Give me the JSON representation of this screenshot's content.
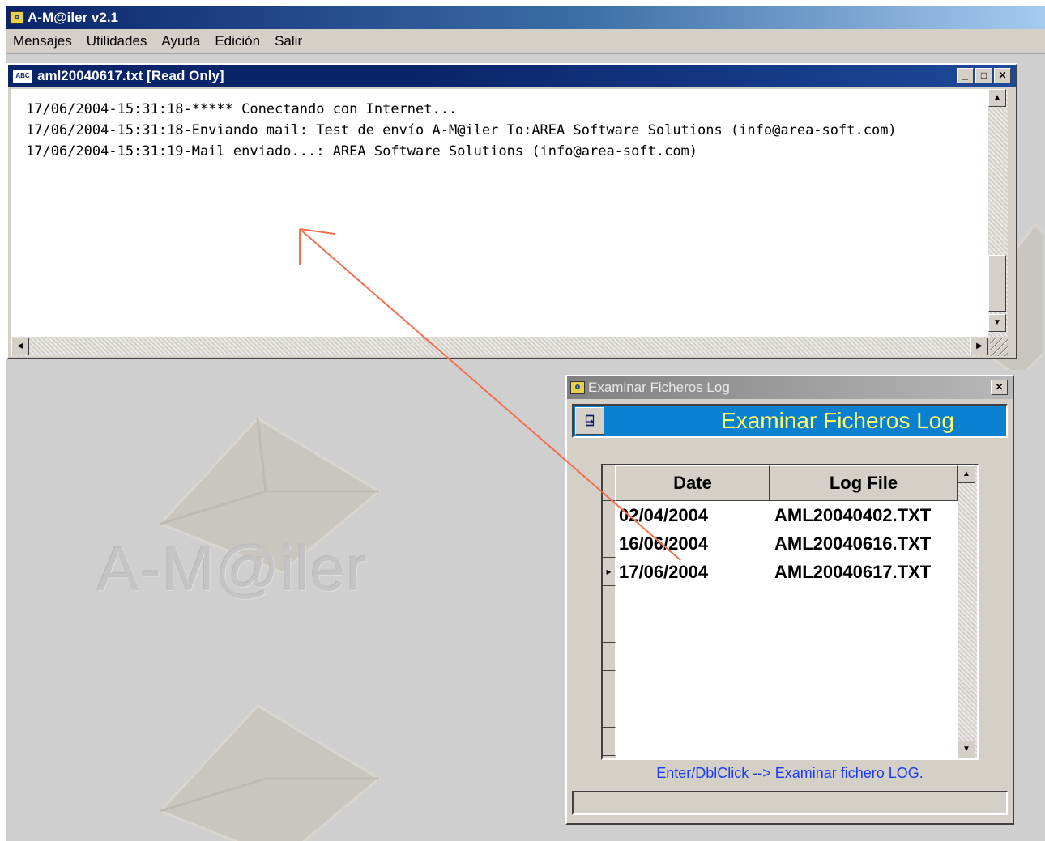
{
  "app": {
    "title": "A-M@iler v2.1",
    "menu": [
      "Mensajes",
      "Utilidades",
      "Ayuda",
      "Edición",
      "Salir"
    ]
  },
  "watermark": {
    "text": "A-M@iler",
    "color": "#c4c4c4"
  },
  "log_window": {
    "title": "aml20040617.txt [Read Only]",
    "icon": "abc-text-icon",
    "icon_label": "ABC",
    "controls": [
      "minimize-icon",
      "maximize-icon",
      "close-icon"
    ],
    "lines": [
      "17/06/2004-15:31:18-***** Conectando con Internet...",
      "17/06/2004-15:31:18-Enviando mail: Test de envío A-M@iler To:AREA Software Solutions (info@area-soft.com)",
      "17/06/2004-15:31:19-Mail enviado...: AREA Software Solutions (info@area-soft.com)"
    ]
  },
  "log_dialog": {
    "title": "Examinar Ficheros Log",
    "banner_title": "Examinar Ficheros Log",
    "banner_color": "#0b7fd0",
    "banner_text_color": "#ffff66",
    "exit_icon": "exit-door-icon",
    "columns": [
      "Date",
      "Log File"
    ],
    "rows": [
      {
        "date": "02/04/2004",
        "file": "AML20040402.TXT"
      },
      {
        "date": "16/06/2004",
        "file": "AML20040616.TXT"
      },
      {
        "date": "17/06/2004",
        "file": "AML20040617.TXT"
      }
    ],
    "selected_row": 2,
    "hint": "Enter/DblClick --> Examinar fichero LOG.",
    "hint_color": "#1c3cf0",
    "status": ""
  },
  "annotation": {
    "arrow_color": "#f07050"
  }
}
